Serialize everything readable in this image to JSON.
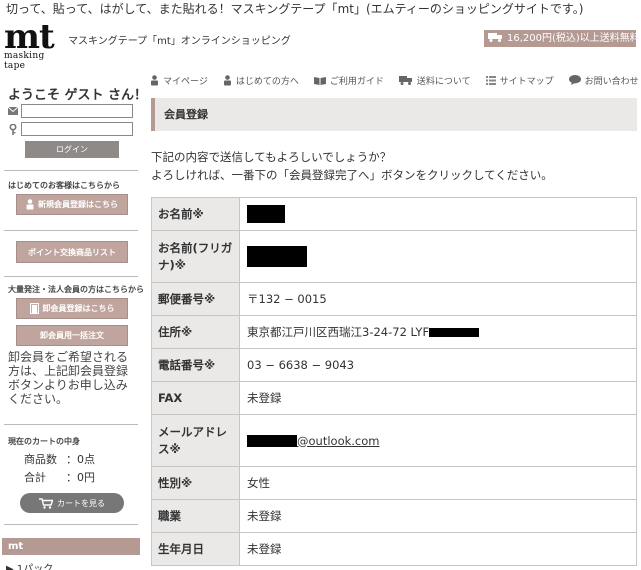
{
  "header": {
    "tagline": "切って、貼って、はがして、また貼れる！マスキングテープ「mt」(エムティーのショッピングサイトです。)",
    "logo_text": "mt",
    "logo_sub": "masking tape",
    "shop_title": "マスキングテープ「mt」オンラインショッピング",
    "shipping_badge": "16,200円(税込)以上送料無料"
  },
  "nav": [
    {
      "label": "マイページ",
      "icon": "person-icon"
    },
    {
      "label": "はじめての方へ",
      "icon": "person-icon"
    },
    {
      "label": "ご利用ガイド",
      "icon": "book-icon"
    },
    {
      "label": "送料について",
      "icon": "truck-icon"
    },
    {
      "label": "サイトマップ",
      "icon": "list-icon"
    },
    {
      "label": "お問い合わせ",
      "icon": "speech-bubble-icon"
    }
  ],
  "sidebar": {
    "welcome": "ようこそ ゲスト さん！",
    "email_value": "",
    "password_value": "",
    "login_label": "ログイン",
    "first_time_caption": "はじめてのお客様はこちらから",
    "register_label": "新規会員登録はこちら",
    "points_label": "ポイント交換商品リスト",
    "wholesale_caption": "大量発注・法人会員の方はこちらから",
    "wholesale_register_label": "卸会員登録はこちら",
    "wholesale_order_label": "卸会員用一括注文",
    "wholesale_note": "卸会員をご希望される方は、上記卸会員登録ボタンよりお申し込みください。",
    "cart_title": "現在のカートの中身",
    "cart_count_label": "商品数",
    "cart_count_value": "：0点",
    "cart_total_label": "合計",
    "cart_total_value": "：0円",
    "cart_button": "カートを見る",
    "mt_header": "mt",
    "mt_sub": "▶ 1パック"
  },
  "main": {
    "section_title": "会員登録",
    "confirm_line1": "下記の内容で送信してもよろしいでしょうか？",
    "confirm_line2": "よろしければ、一番下の「会員登録完了へ」ボタンをクリックしてください。",
    "rows": [
      {
        "label": "お名前※",
        "value": ""
      },
      {
        "label": "お名前(フリガナ)※",
        "value": ""
      },
      {
        "label": "郵便番号※",
        "value": "〒132 − 0015"
      },
      {
        "label": "住所※",
        "value": "東京都江戸川区西瑞江3-24-72 LYF"
      },
      {
        "label": "電話番号※",
        "value": "03 − 6638 − 9043"
      },
      {
        "label": "FAX",
        "value": "未登録"
      },
      {
        "label": "メールアドレス※",
        "value": "@outlook.com"
      },
      {
        "label": "性別※",
        "value": "女性"
      },
      {
        "label": "職業",
        "value": "未登録"
      },
      {
        "label": "生年月日",
        "value": "未登録"
      }
    ]
  },
  "colors": {
    "accent": "#b59a94",
    "label_bg": "#ebe9e8",
    "button_gray": "#8f8a88"
  }
}
